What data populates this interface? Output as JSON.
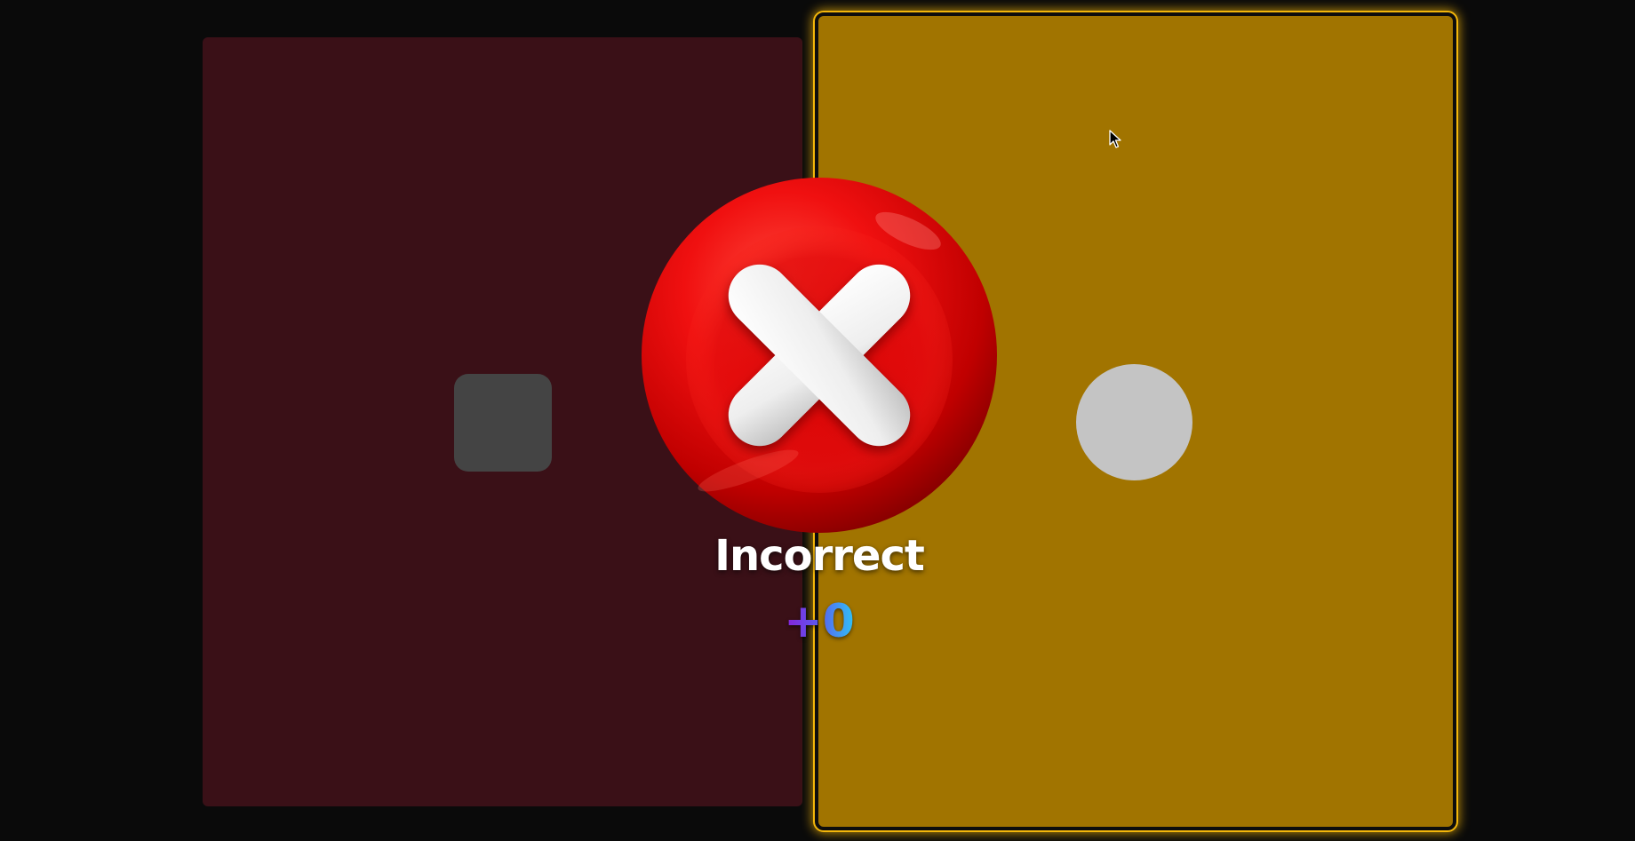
{
  "colors": {
    "background": "#0a0a0a",
    "left_card": "#3a1017",
    "right_card": "#a17400",
    "right_card_glow": "#f3b60a",
    "square": "#444444",
    "circle": "#c4c4c4",
    "x_badge": "#e81010",
    "x_mark": "#f4f4f4"
  },
  "cards": {
    "left": {
      "shape": "square"
    },
    "right": {
      "shape": "circle",
      "state": "selected"
    }
  },
  "feedback": {
    "icon": "x-icon",
    "result_text": "Incorrect",
    "points_text": "+0"
  }
}
